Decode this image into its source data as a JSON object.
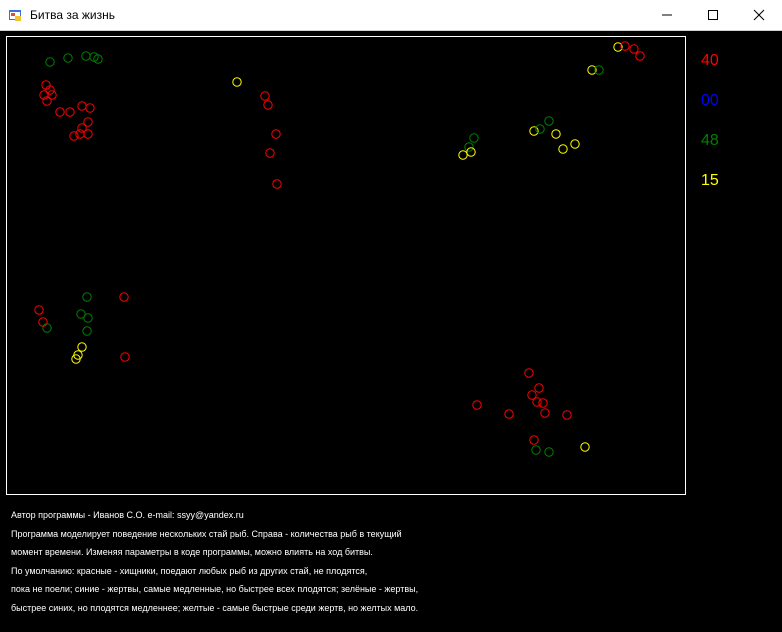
{
  "window": {
    "title": "Битва за жизнь",
    "icon": "form-app-icon",
    "controls": [
      "minimize-icon",
      "maximize-icon",
      "close-icon"
    ]
  },
  "counts": [
    {
      "color_name": "red",
      "value": "40",
      "color": "#ff0000"
    },
    {
      "color_name": "blue",
      "value": "00",
      "color": "#0000ff"
    },
    {
      "color_name": "green",
      "value": "48",
      "color": "#008000"
    },
    {
      "color_name": "yellow",
      "value": "15",
      "color": "#ffff00"
    }
  ],
  "description": [
    "Автор программы - Иванов С.О. e-mail: ssyy@yandex.ru",
    "Программа моделирует поведение нескольких стай рыб. Справа - количества рыб в текущий",
    "момент времени. Изменяя параметры в коде программы, можно влиять на ход битвы.",
    "По умолчанию: красные - хищники, поедают любых рыб из других стай, не плодятся,",
    "пока не поели; синие - жертвы, самые медленные, но быстрее всех плодятся; зелёные - жертвы,",
    "быстрее синих, но плодятся медленнее; желтые - самые быстрые среди жертв, но желтых мало."
  ],
  "colors": {
    "background": "#000000",
    "border": "#ffffff",
    "red": "#ff0000",
    "green": "#008000",
    "yellow": "#ffff00",
    "blue": "#0000ff"
  }
}
